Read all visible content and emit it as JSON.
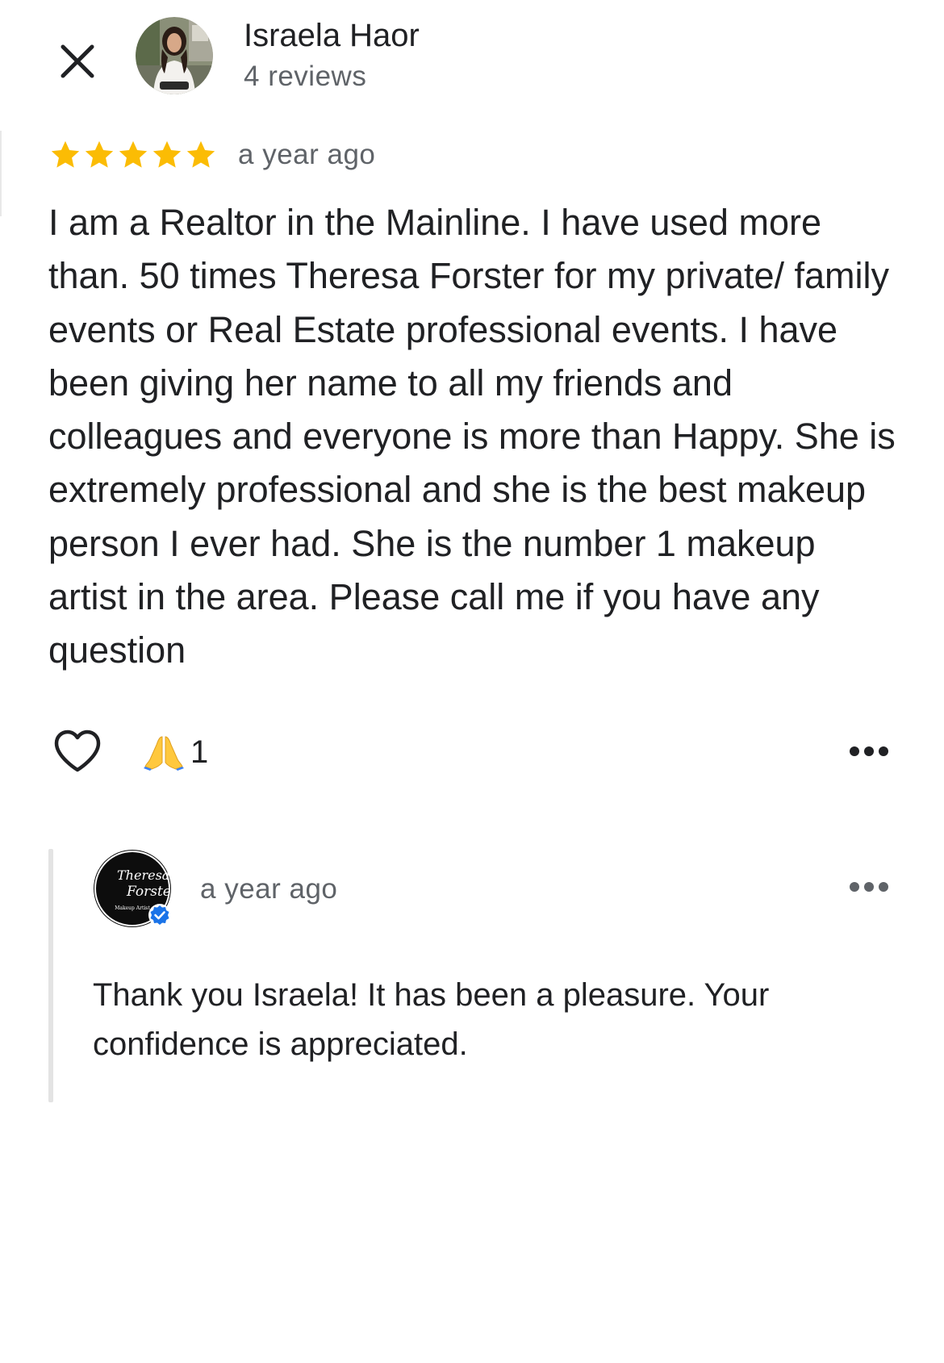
{
  "header": {
    "close_icon": "close-icon",
    "reviewer_name": "Israela Haor",
    "reviewer_meta": "4 reviews"
  },
  "review": {
    "rating": 5,
    "rating_max": 5,
    "star_color": "#fbbc04",
    "time": "a year ago",
    "text": "I am a Realtor in the Mainline. I have used more than. 50 times Theresa Forster for my private/ family events or Real Estate professional events. I have been giving her name to all my friends and colleagues and everyone is more than Happy. She is extremely professional and she is the best makeup person I ever had. She is the number 1 makeup artist in the area. Please call me if you have any question",
    "like_icon": "heart-outline-icon",
    "reaction_emoji": "🙏",
    "reaction_count": "1",
    "more_icon": "more-horizontal-icon"
  },
  "owner_reply": {
    "logo_lines": [
      "Theresa",
      "Forster",
      "Makeup Artist"
    ],
    "verified_icon": "verified-badge-icon",
    "verified_color": "#1a73e8",
    "time": "a year ago",
    "text": "Thank you Israela! It has been a pleasure. Your confidence is appreciated.",
    "more_icon": "more-horizontal-icon"
  }
}
